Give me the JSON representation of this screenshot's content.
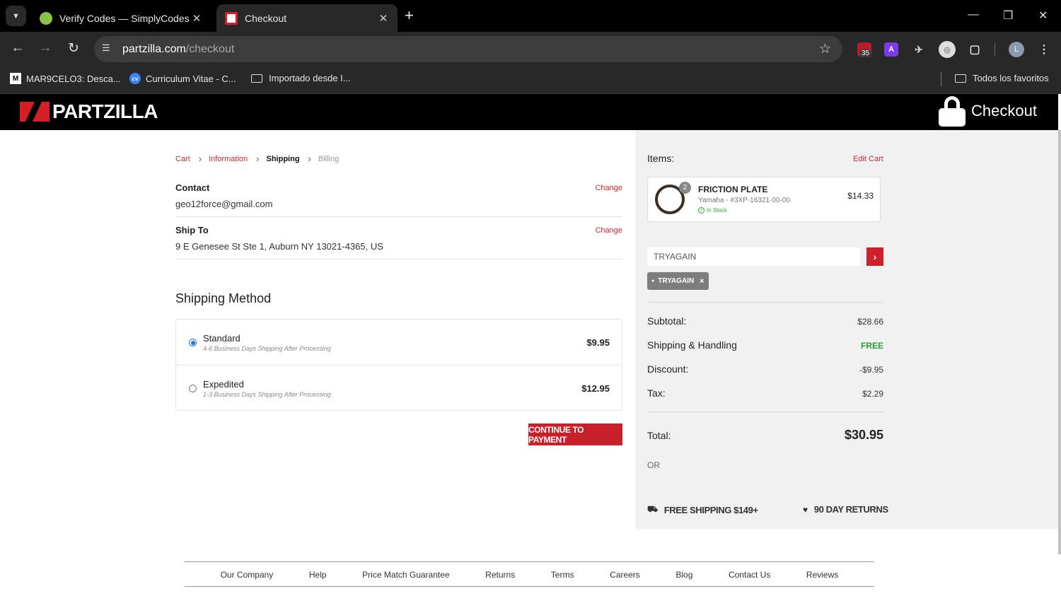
{
  "browser": {
    "tabs": [
      {
        "title": "Verify Codes — SimplyCodes",
        "active": false
      },
      {
        "title": "Checkout",
        "active": true
      }
    ],
    "url_host": "partzilla.com",
    "url_path": "/checkout",
    "extension_badge": "35",
    "extension_letter": "A",
    "profile_letter": "L",
    "bookmarks": [
      "MAR9CELO3: Desca...",
      "Curriculum Vitae - C...",
      "Importado desde I..."
    ],
    "bookmark_icons": [
      "M",
      "cv"
    ],
    "all_bookmarks": "Todos los favoritos"
  },
  "header": {
    "logo": "PARTZILLA",
    "checkout_label": "Checkout"
  },
  "breadcrumb": [
    "Cart",
    "Information",
    "Shipping",
    "Billing"
  ],
  "contact": {
    "label": "Contact",
    "value": "geo12force@gmail.com",
    "change": "Change"
  },
  "ship_to": {
    "label": "Ship To",
    "value": "9 E Genesee St Ste 1, Auburn NY 13021-4365, US",
    "change": "Change"
  },
  "shipping": {
    "title": "Shipping Method",
    "options": [
      {
        "name": "Standard",
        "desc": "4-6 Business Days Shipping After Processing",
        "price": "$9.95",
        "selected": true
      },
      {
        "name": "Expedited",
        "desc": "1-3 Business Days Shipping After Processing",
        "price": "$12.95",
        "selected": false
      }
    ],
    "continue_label": "CONTINUE TO PAYMENT"
  },
  "cart": {
    "items_label": "Items:",
    "edit_label": "Edit Cart",
    "item": {
      "qty": "2",
      "name": "FRICTION PLATE",
      "sub": "Yamaha - #3XP-16321-00-00",
      "stock": "In Stock",
      "price": "$14.33"
    },
    "coupon_value": "TRYAGAIN",
    "applied_coupon": "TRYAGAIN",
    "subtotal_label": "Subtotal:",
    "subtotal": "$28.66",
    "shipping_label": "Shipping & Handling",
    "shipping": "FREE",
    "discount_label": "Discount:",
    "discount": "-$9.95",
    "tax_label": "Tax:",
    "tax": "$2.29",
    "total_label": "Total:",
    "total": "$30.95",
    "or_label": "OR",
    "perk_shipping": "FREE SHIPPING $149+",
    "perk_returns": "90 DAY RETURNS"
  },
  "footer": [
    "Our Company",
    "Help",
    "Price Match Guarantee",
    "Returns",
    "Terms",
    "Careers",
    "Blog",
    "Contact Us",
    "Reviews"
  ],
  "colors": {
    "brand_red": "#c8202b",
    "success": "#2a9d3a",
    "sidebar_bg": "#f1f1f1"
  }
}
